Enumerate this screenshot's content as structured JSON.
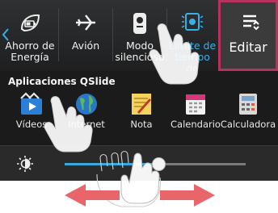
{
  "toggles": [
    {
      "label": "Ahorro de Energía",
      "icon": "battery-saver-icon",
      "active": false
    },
    {
      "label": "Avión",
      "icon": "airplane-icon",
      "active": false
    },
    {
      "label": "Modo silencioso",
      "icon": "silent-mode-icon",
      "active": false
    },
    {
      "label": "Límite de tiempo de",
      "icon": "screen-timeout-icon",
      "active": true
    }
  ],
  "edit": {
    "label": "Editar",
    "icon": "edit-list-icon"
  },
  "qslide": {
    "title": "Aplicaciones QSlide",
    "apps": [
      {
        "label": "Vídeos",
        "icon": "videos-icon"
      },
      {
        "label": "Internet",
        "icon": "internet-globe-icon"
      },
      {
        "label": "Nota",
        "icon": "note-icon"
      },
      {
        "label": "Calendario",
        "icon": "calendar-icon"
      },
      {
        "label": "Calculadora",
        "icon": "calculator-icon"
      }
    ]
  },
  "brightness": {
    "icon": "brightness-icon",
    "level": 0.52
  },
  "colors": {
    "accent": "#36a9e1",
    "edit_border": "#b7325c",
    "swipe_arrow": "#e8656a"
  }
}
